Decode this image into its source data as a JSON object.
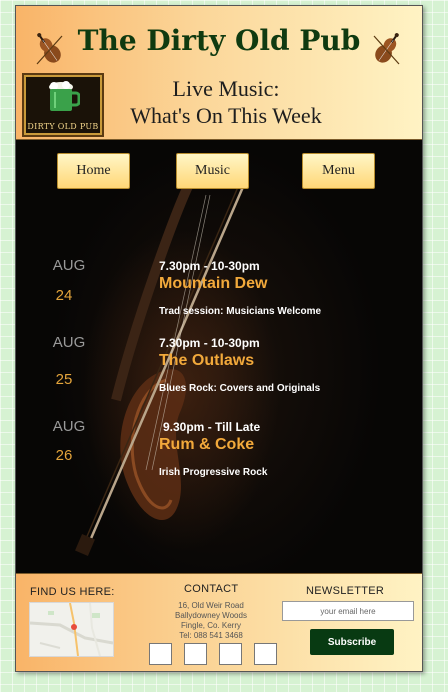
{
  "header": {
    "title": "The Dirty Old Pub",
    "logo_text": "DIRTY OLD PUB",
    "subtitle_line1": "Live Music:",
    "subtitle_line2": "What's On This Week"
  },
  "nav": {
    "items": [
      {
        "label": "Home"
      },
      {
        "label": "Music"
      },
      {
        "label": "Menu"
      }
    ]
  },
  "events": [
    {
      "month": "AUG",
      "day": "24",
      "time": "7.30pm - 10-30pm",
      "name": "Mountain Dew",
      "description": "Trad session: Musicians Welcome"
    },
    {
      "month": "AUG",
      "day": "25",
      "time": "7.30pm - 10-30pm",
      "name": "The Outlaws",
      "description": "Blues Rock: Covers and Originals"
    },
    {
      "month": "AUG",
      "day": "26",
      "time": "9.30pm - Till Late",
      "name": "Rum & Coke",
      "description": "Irish Progressive Rock"
    }
  ],
  "footer": {
    "find_us": "FIND US HERE:",
    "contact": {
      "label": "CONTACT",
      "address_line1": "16, Old Weir Road",
      "address_line2": "Ballydowney Woods",
      "address_line3": "Fingle, Co. Kerry",
      "phone": "Tel: 088 541 3468"
    },
    "newsletter": {
      "label": "NEWSLETTER",
      "placeholder": "your email here",
      "button": "Subscribe"
    }
  },
  "colors": {
    "accent": "#f2a93b",
    "title_green": "#0f3a10",
    "subscribe_bg": "#083a12"
  }
}
